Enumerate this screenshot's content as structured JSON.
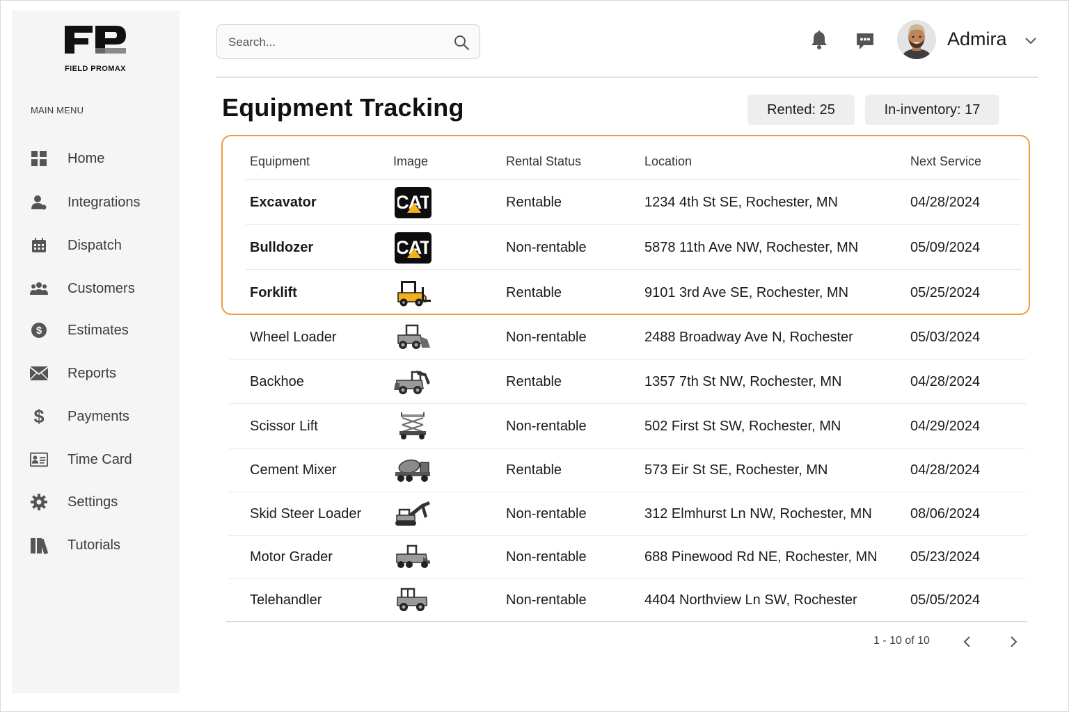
{
  "brand": {
    "logo_text": "FIELD PROMAX"
  },
  "sidebar": {
    "heading": "MAIN MENU",
    "items": [
      {
        "label": "Home",
        "icon": "home-grid-icon"
      },
      {
        "label": "Integrations",
        "icon": "user-gear-icon"
      },
      {
        "label": "Dispatch",
        "icon": "calendar-icon"
      },
      {
        "label": "Customers",
        "icon": "users-icon"
      },
      {
        "label": "Estimates",
        "icon": "dollar-circle-icon"
      },
      {
        "label": "Reports",
        "icon": "envelope-icon"
      },
      {
        "label": "Payments",
        "icon": "dollar-sign-icon"
      },
      {
        "label": "Time Card",
        "icon": "id-card-icon"
      },
      {
        "label": "Settings",
        "icon": "gear-icon"
      },
      {
        "label": "Tutorials",
        "icon": "books-icon"
      }
    ]
  },
  "header": {
    "search_placeholder": "Search...",
    "user_name": "Admira"
  },
  "page": {
    "title": "Equipment Tracking",
    "badges": {
      "rented": "Rented: 25",
      "inventory": "In-inventory: 17"
    }
  },
  "table": {
    "columns": [
      "Equipment",
      "Image",
      "Rental Status",
      "Location",
      "Next Service"
    ],
    "rows": [
      {
        "name": "Excavator",
        "image": "cat-logo",
        "status": "Rentable",
        "location": "1234 4th St SE, Rochester, MN",
        "next_service": "04/28/2024"
      },
      {
        "name": "Bulldozer",
        "image": "cat-logo",
        "status": "Non-rentable",
        "location": "5878 11th Ave NW, Rochester, MN",
        "next_service": "05/09/2024"
      },
      {
        "name": "Forklift",
        "image": "forklift-icon",
        "status": "Rentable",
        "location": "9101 3rd Ave SE, Rochester, MN",
        "next_service": "05/25/2024"
      },
      {
        "name": "Wheel Loader",
        "image": "wheel-loader-icon",
        "status": "Non-rentable",
        "location": "2488 Broadway Ave N, Rochester",
        "next_service": "05/03/2024"
      },
      {
        "name": "Backhoe",
        "image": "backhoe-icon",
        "status": "Rentable",
        "location": "1357 7th St NW, Rochester, MN",
        "next_service": "04/28/2024"
      },
      {
        "name": "Scissor Lift",
        "image": "scissor-lift-icon",
        "status": "Non-rentable",
        "location": "502 First St SW, Rochester, MN",
        "next_service": "04/29/2024"
      },
      {
        "name": "Cement Mixer",
        "image": "cement-mixer-icon",
        "status": "Rentable",
        "location": "573 Eir St SE, Rochester, MN",
        "next_service": "04/28/2024"
      },
      {
        "name": "Skid Steer Loader",
        "image": "excavator-arm-icon",
        "status": "Non-rentable",
        "location": "312 Elmhurst Ln NW, Rochester, MN",
        "next_service": "08/06/2024"
      },
      {
        "name": "Motor Grader",
        "image": "motor-grader-icon",
        "status": "Non-rentable",
        "location": "688 Pinewood Rd NE, Rochester, MN",
        "next_service": "05/23/2024"
      },
      {
        "name": "Telehandler",
        "image": "telehandler-icon",
        "status": "Non-rentable",
        "location": "4404 Northview Ln SW, Rochester",
        "next_service": "05/05/2024"
      }
    ]
  },
  "pagination": {
    "info": "1 - 10 of 10"
  },
  "colors": {
    "accent": "#f19a3e",
    "rentable": "#2f9a3b",
    "non_rentable_highlight": "#ef8a1a",
    "non_rentable": "#7b7b7b",
    "cat_yellow": "#f6b21b"
  }
}
